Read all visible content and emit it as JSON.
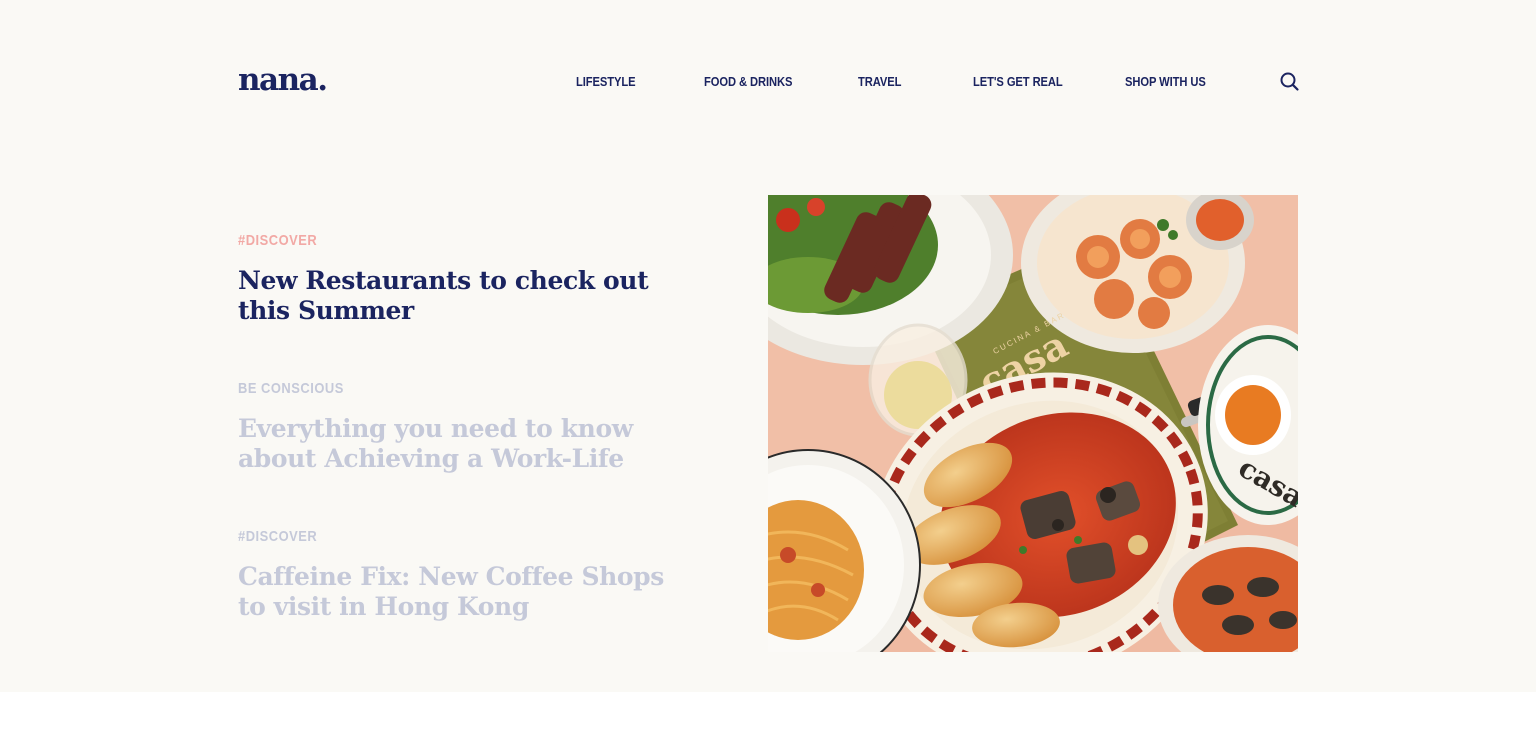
{
  "brand": {
    "logo_text": "nana."
  },
  "nav": {
    "items": [
      {
        "label": "LIFESTYLE"
      },
      {
        "label": "FOOD & DRINKS"
      },
      {
        "label": "TRAVEL"
      },
      {
        "label": "LET'S GET REAL"
      },
      {
        "label": "SHOP WITH US"
      }
    ],
    "search_icon": "search-icon"
  },
  "featured": {
    "articles": [
      {
        "category": "#DISCOVER",
        "title": "New Restaurants to check out this Summer",
        "state": "active"
      },
      {
        "category": "BE CONSCIOUS",
        "title": "Everything you need to know about Achieving a Work-Life",
        "state": "inactive"
      },
      {
        "category": "#DISCOVER",
        "title": "Caffeine Fix: New Coffee Shops to visit in Hong Kong",
        "state": "inactive"
      }
    ],
    "image": {
      "menu_brand": "casa",
      "menu_subtitle": "CUCINA & BAR",
      "plate_text": "casa"
    }
  },
  "colors": {
    "navy": "#1b2460",
    "coral": "#f2a9a5",
    "muted": "#c5c9d9",
    "hero_bg": "#faf9f5",
    "page_bg": "#ffffff"
  }
}
